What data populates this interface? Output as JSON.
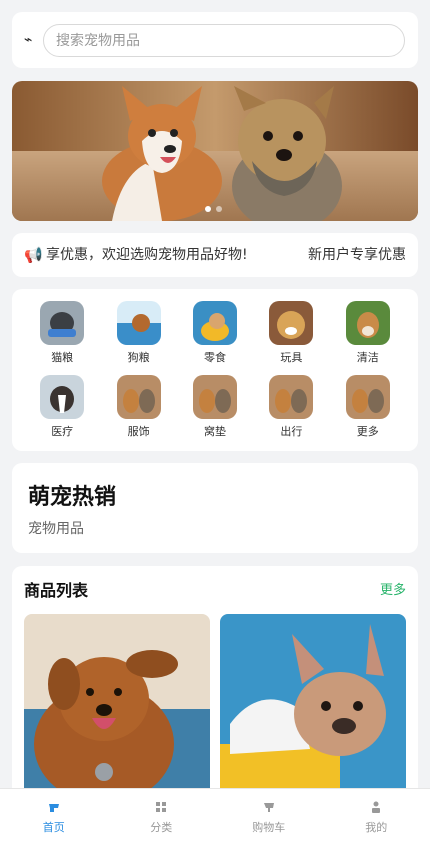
{
  "search": {
    "placeholder": "搜索宠物用品",
    "scan_icon": "scan-icon"
  },
  "banner": {
    "slides": 2,
    "active_index": 0
  },
  "notice": {
    "icon": "megaphone-icon",
    "text": "专享优惠，欢迎选购宠物用品好物!",
    "right": "新用户专享优惠"
  },
  "categories": [
    {
      "label": "猫粮"
    },
    {
      "label": "狗粮"
    },
    {
      "label": "零食"
    },
    {
      "label": "玩具"
    },
    {
      "label": "清洁"
    },
    {
      "label": "医疗"
    },
    {
      "label": "服饰"
    },
    {
      "label": "窝垫"
    },
    {
      "label": "出行"
    },
    {
      "label": "更多"
    }
  ],
  "hot": {
    "title": "萌宠热销",
    "subtitle": "宠物用品"
  },
  "product_list": {
    "title": "商品列表",
    "more": "更多"
  },
  "tabbar": {
    "items": [
      {
        "label": "首页",
        "icon": "home-icon",
        "active": true
      },
      {
        "label": "分类",
        "icon": "grid-icon",
        "active": false
      },
      {
        "label": "购物车",
        "icon": "cart-icon",
        "active": false
      },
      {
        "label": "我的",
        "icon": "user-icon",
        "active": false
      }
    ]
  },
  "colors": {
    "accent_green": "#27b36a",
    "tab_active": "#2b8de0",
    "background": "#f2f3f5"
  }
}
